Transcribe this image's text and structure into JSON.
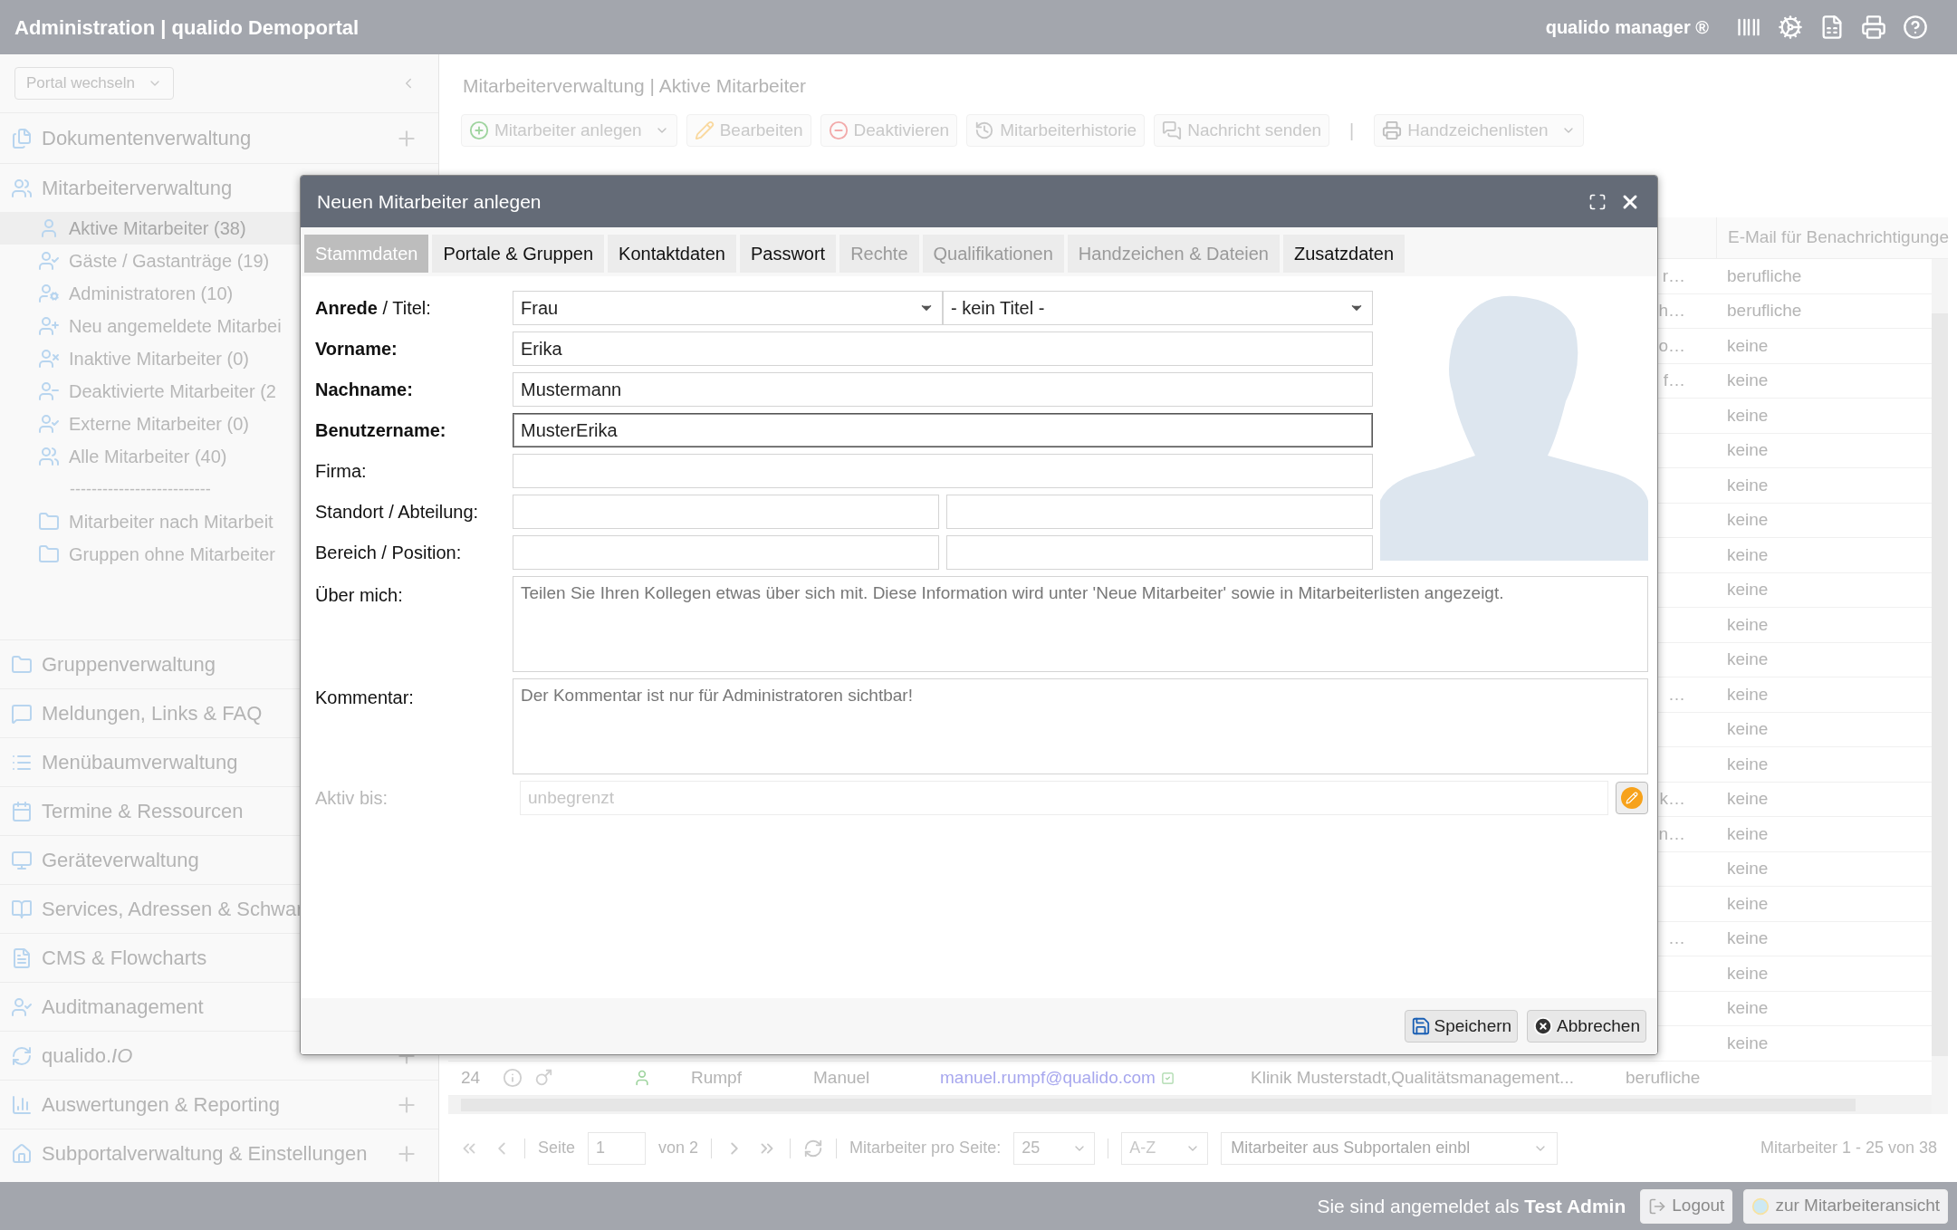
{
  "header": {
    "title": "Administration | qualido Demoportal",
    "brand": "qualido manager ®"
  },
  "sidebar": {
    "portal_select": "Portal wechseln",
    "sections": [
      {
        "label": "Dokumentenverwaltung",
        "plus": true
      },
      {
        "label": "Mitarbeiterverwaltung",
        "plus": false,
        "children": [
          {
            "kind": "link",
            "label": "Aktive Mitarbeiter (38)",
            "selected": true
          },
          {
            "kind": "link",
            "label": "Gäste / Gastanträge (19)",
            "selected": false
          },
          {
            "kind": "link",
            "label": "Administratoren (10)",
            "selected": false
          },
          {
            "kind": "link",
            "label": "Neu angemeldete Mitarbei",
            "selected": false
          },
          {
            "kind": "link",
            "label": "Inaktive Mitarbeiter (0)",
            "selected": false
          },
          {
            "kind": "link",
            "label": "Deaktivierte Mitarbeiter (2",
            "selected": false
          },
          {
            "kind": "link",
            "label": "Externe Mitarbeiter (0)",
            "selected": false
          },
          {
            "kind": "link",
            "label": "Alle Mitarbeiter (40)",
            "selected": false
          },
          {
            "kind": "separator",
            "label": "--------------------------"
          },
          {
            "kind": "link",
            "label": "Mitarbeiter nach Mitarbeit",
            "selected": false
          },
          {
            "kind": "link",
            "label": "Gruppen ohne Mitarbeiter",
            "selected": false
          }
        ]
      },
      {
        "label": "Gruppenverwaltung",
        "plus": false
      },
      {
        "label": "Meldungen, Links & FAQ",
        "plus": false
      },
      {
        "label": "Menübaumverwaltung",
        "plus": false
      },
      {
        "label": "Termine & Ressourcen",
        "plus": false
      },
      {
        "label": "Geräteverwaltung",
        "plus": false
      },
      {
        "label": "Services, Adressen & Schwar",
        "plus": false
      },
      {
        "label": "CMS & Flowcharts",
        "plus": false
      },
      {
        "label": "Auditmanagement",
        "plus": false
      },
      {
        "label": "qualido.*IO*",
        "plus": true
      },
      {
        "label": "Auswertungen & Reporting",
        "plus": true
      },
      {
        "label": "Subportalverwaltung & Einstellungen",
        "plus": true
      }
    ]
  },
  "main": {
    "breadcrumb": "Mitarbeiterverwaltung | Aktive Mitarbeiter",
    "toolbar": [
      {
        "kind": "button",
        "label": "Mitarbeiter anlegen",
        "dropdown": true
      },
      {
        "kind": "button",
        "label": "Bearbeiten",
        "dropdown": false
      },
      {
        "kind": "button",
        "label": "Deaktivieren",
        "dropdown": false
      },
      {
        "kind": "button",
        "label": "Mitarbeiterhistorie",
        "dropdown": false
      },
      {
        "kind": "button",
        "label": "Nachricht senden",
        "dropdown": false
      },
      {
        "kind": "separator",
        "label": "|"
      },
      {
        "kind": "button",
        "label": "Handzeichenlisten",
        "dropdown": true
      }
    ],
    "table": {
      "column_header": "E-Mail für Benachrichtigunge",
      "rows": [
        {
          "kind": "partial",
          "fragment": "r…",
          "notification": "berufliche"
        },
        {
          "kind": "partial",
          "fragment": "h…",
          "notification": "berufliche"
        },
        {
          "kind": "partial",
          "fragment": "o…",
          "notification": "keine"
        },
        {
          "kind": "partial",
          "fragment": "f…",
          "notification": "keine"
        },
        {
          "kind": "partial",
          "notification": "keine"
        },
        {
          "kind": "partial",
          "notification": "keine"
        },
        {
          "kind": "partial",
          "notification": "keine"
        },
        {
          "kind": "partial",
          "notification": "keine"
        },
        {
          "kind": "partial",
          "notification": "keine"
        },
        {
          "kind": "partial",
          "notification": "keine"
        },
        {
          "kind": "partial",
          "notification": "keine"
        },
        {
          "kind": "partial",
          "notification": "keine"
        },
        {
          "kind": "partial",
          "fragment": "…",
          "notification": "keine"
        },
        {
          "kind": "partial",
          "notification": "keine"
        },
        {
          "kind": "partial",
          "notification": "keine"
        },
        {
          "kind": "partial",
          "fragment": "k…",
          "notification": "keine"
        },
        {
          "kind": "partial",
          "fragment": "n…",
          "notification": "keine"
        },
        {
          "kind": "partial",
          "notification": "keine"
        },
        {
          "kind": "partial",
          "notification": "keine"
        },
        {
          "kind": "partial",
          "fragment": "…",
          "notification": "keine"
        },
        {
          "kind": "partial",
          "notification": "keine"
        },
        {
          "kind": "partial",
          "notification": "keine"
        },
        {
          "kind": "partial",
          "notification": "keine"
        },
        {
          "kind": "full",
          "number": "24",
          "last_name": "Rumpf",
          "first_name": "Manuel",
          "email": "manuel.rumpf@qualido.com",
          "email_confirmed": true,
          "organisation": "Klinik Musterstadt,Qualitätsmanagement...",
          "notification": "berufliche"
        }
      ]
    },
    "pagination": {
      "page_label": "Seite",
      "page": "1",
      "of": "von 2",
      "per_page_label": "Mitarbeiter pro Seite:",
      "per_page": "25",
      "sort": "A-Z",
      "subportal_placeholder": "Mitarbeiter aus Subportalen einbl",
      "summary": "Mitarbeiter 1 - 25 von 38"
    }
  },
  "footer": {
    "login_text": "Sie sind angemeldet als **Test Admin**",
    "logout": "Logout",
    "view_button": "zur Mitarbeiteransicht"
  },
  "dialog": {
    "title": "Neuen Mitarbeiter anlegen",
    "tabs": [
      {
        "label": "Stammdaten",
        "selected": true,
        "disabled": false
      },
      {
        "label": "Portale & Gruppen",
        "selected": false,
        "disabled": false
      },
      {
        "label": "Kontaktdaten",
        "selected": false,
        "disabled": false
      },
      {
        "label": "Passwort",
        "selected": false,
        "disabled": false
      },
      {
        "label": "Rechte",
        "selected": false,
        "disabled": true
      },
      {
        "label": "Qualifikationen",
        "selected": false,
        "disabled": true
      },
      {
        "label": "Handzeichen & Dateien",
        "selected": false,
        "disabled": true
      },
      {
        "label": "Zusatzdaten",
        "selected": false,
        "disabled": false
      }
    ],
    "fields": [
      {
        "kind": "select_pair",
        "label": "**Anrede** / Titel:",
        "bold": false,
        "values": [
          "Frau",
          "- kein Titel -"
        ]
      },
      {
        "kind": "text",
        "label": "Vorname:",
        "bold": true,
        "value": "Erika",
        "focused": false
      },
      {
        "kind": "text",
        "label": "Nachname:",
        "bold": true,
        "value": "Mustermann",
        "focused": false
      },
      {
        "kind": "text",
        "label": "Benutzername:",
        "bold": true,
        "value": "MusterErika",
        "focused": true
      },
      {
        "kind": "text",
        "label": "Firma:",
        "bold": false,
        "focused": false
      },
      {
        "kind": "pair",
        "label": "Standort / Abteilung:",
        "bold": false
      },
      {
        "kind": "pair",
        "label": "Bereich / Position:",
        "bold": false
      },
      {
        "kind": "textarea",
        "label": "Über mich:",
        "bold": false,
        "placeholder": "Teilen Sie Ihren Kollegen etwas über sich mit. Diese Information wird unter 'Neue Mitarbeiter' sowie in Mitarbeiterlisten angezeigt."
      },
      {
        "kind": "textarea",
        "label": "Kommentar:",
        "bold": false,
        "placeholder": "Der Kommentar ist nur für Administratoren sichtbar!"
      },
      {
        "kind": "date",
        "label": "Aktiv bis:",
        "bold": false,
        "placeholder": "unbegrenzt",
        "disabled": true
      }
    ],
    "buttons": [
      {
        "kind": "save",
        "label": "Speichern"
      },
      {
        "kind": "cancel",
        "label": "Abbrechen"
      }
    ]
  }
}
